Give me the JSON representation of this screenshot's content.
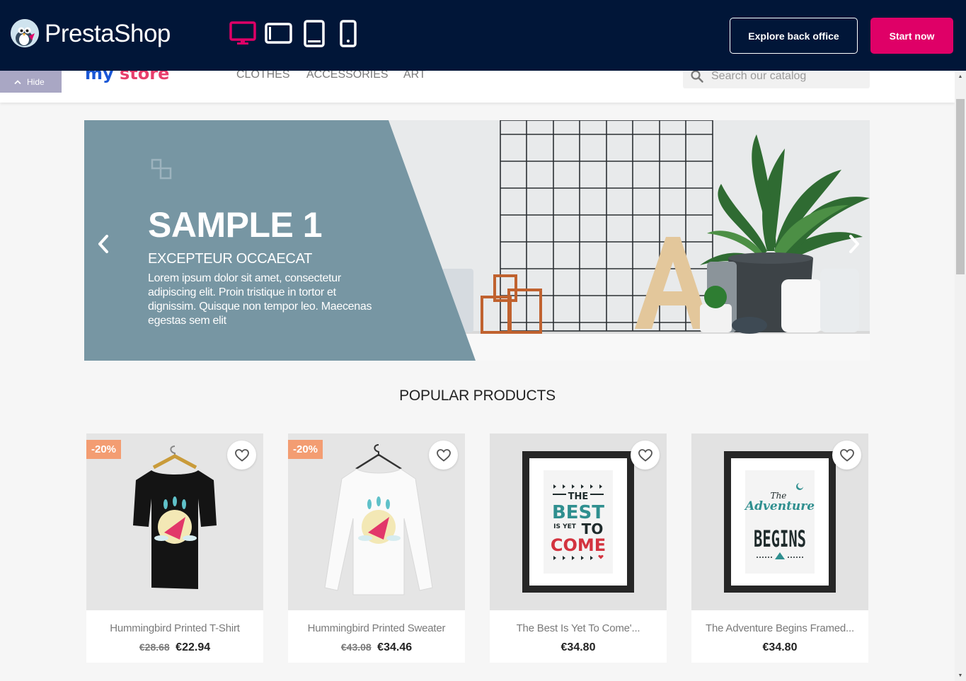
{
  "demo_bar": {
    "brand": "PrestaShop",
    "explore_label": "Explore back office",
    "start_label": "Start now",
    "accent_color": "#df0067",
    "background_color": "#011638",
    "devices": [
      {
        "name": "desktop-icon",
        "active": true
      },
      {
        "name": "tablet-landscape-icon",
        "active": false
      },
      {
        "name": "tablet-portrait-icon",
        "active": false
      },
      {
        "name": "mobile-icon",
        "active": false
      }
    ]
  },
  "header": {
    "logo_part1": "my",
    "logo_part2": "store",
    "nav": [
      "CLOTHES",
      "ACCESSORIES",
      "ART"
    ],
    "search_placeholder": "Search our catalog",
    "hide_label": "Hide"
  },
  "carousel": {
    "title": "SAMPLE 1",
    "subtitle": "EXCEPTEUR OCCAECAT",
    "description": "Lorem ipsum dolor sit amet, consectetur adipiscing elit. Proin tristique in tortor et dignissim. Quisque non tempor leo. Maecenas egestas sem elit",
    "panel_color": "#7796a3"
  },
  "popular": {
    "title": "POPULAR PRODUCTS",
    "products": [
      {
        "name": "Hummingbird Printed T-Shirt",
        "badge": "-20%",
        "old_price": "€28.68",
        "price": "€22.94"
      },
      {
        "name": "Hummingbird Printed Sweater",
        "badge": "-20%",
        "old_price": "€43.08",
        "price": "€34.46"
      },
      {
        "name": "The Best Is Yet To Come'...",
        "badge": "",
        "old_price": "",
        "price": "€34.80",
        "poster_lines": [
          "THE",
          "BEST",
          "IS YET",
          "TO",
          "COME"
        ]
      },
      {
        "name": "The Adventure Begins Framed...",
        "badge": "",
        "old_price": "",
        "price": "€34.80",
        "poster_lines": [
          "The",
          "Adventure",
          "BEGINS"
        ]
      }
    ]
  }
}
